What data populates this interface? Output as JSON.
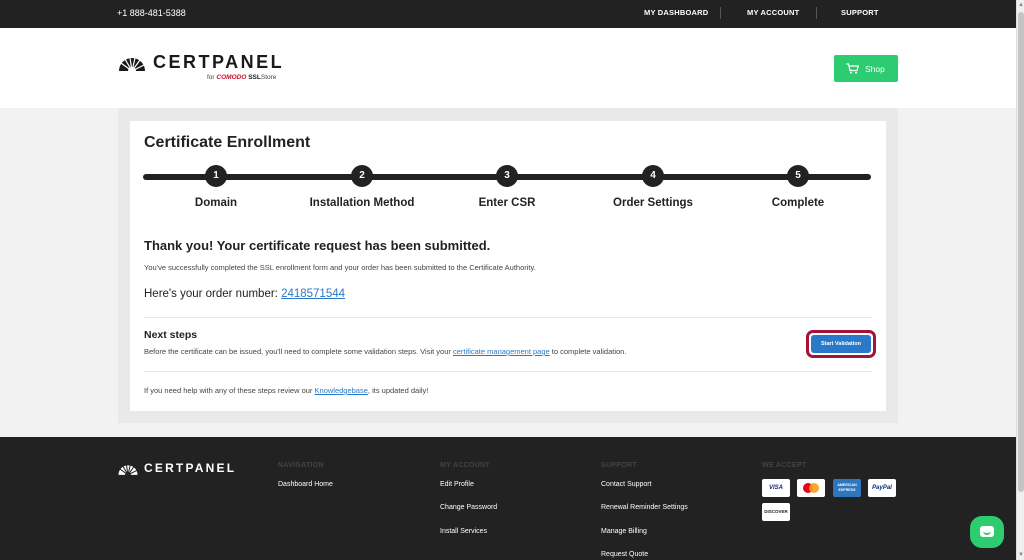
{
  "topbar": {
    "phone": "+1 888-481-5388",
    "nav": [
      "MY DASHBOARD",
      "MY ACCOUNT",
      "SUPPORT"
    ]
  },
  "header": {
    "brand": "CERTPANEL",
    "sub_for": "for",
    "sub_comodo": "COMODO",
    "sub_ssl": "SSL",
    "sub_store": "Store",
    "shop_label": "Shop"
  },
  "enrollment": {
    "title": "Certificate Enrollment",
    "steps": [
      {
        "num": "1",
        "label": "Domain"
      },
      {
        "num": "2",
        "label": "Installation Method"
      },
      {
        "num": "3",
        "label": "Enter CSR"
      },
      {
        "num": "4",
        "label": "Order Settings"
      },
      {
        "num": "5",
        "label": "Complete"
      }
    ],
    "thanks": "Thank you! Your certificate request has been submitted.",
    "description": "You've successfully completed the SSL enrollment form and your order has been submitted to the Certificate Authority.",
    "order_prefix": "Here's your order number: ",
    "order_number": "2418571544",
    "next_title": "Next steps",
    "next_desc_before": "Before the certificate can be issued, you'll need to complete some validation steps. Visit your ",
    "next_desc_link": "certificate management page",
    "next_desc_after": " to complete validation.",
    "validate_label": "Start Validation",
    "help_before": "If you need help with any of these steps review our ",
    "help_link": "Knowledgebase",
    "help_after": ", its updated daily!"
  },
  "footer": {
    "brand": "CERTPANEL",
    "nav_head": "NAVIGATION",
    "nav_links": [
      "Dashboard Home"
    ],
    "account_head": "MY ACCOUNT",
    "account_links": [
      "Edit Profile",
      "Change Password",
      "Install Services"
    ],
    "support_head": "SUPPORT",
    "support_links": [
      "Contact Support",
      "Renewal Reminder Settings",
      "Manage Billing",
      "Request Quote"
    ],
    "accept_head": "WE ACCEPT",
    "cards": [
      "VISA",
      "AMERICAN EXPRESS",
      "PayPal",
      "DISCOVER"
    ]
  },
  "colors": {
    "accent_green": "#2ecc71",
    "link_blue": "#2a79c8",
    "highlight": "#a5123a",
    "dark": "#222222"
  }
}
